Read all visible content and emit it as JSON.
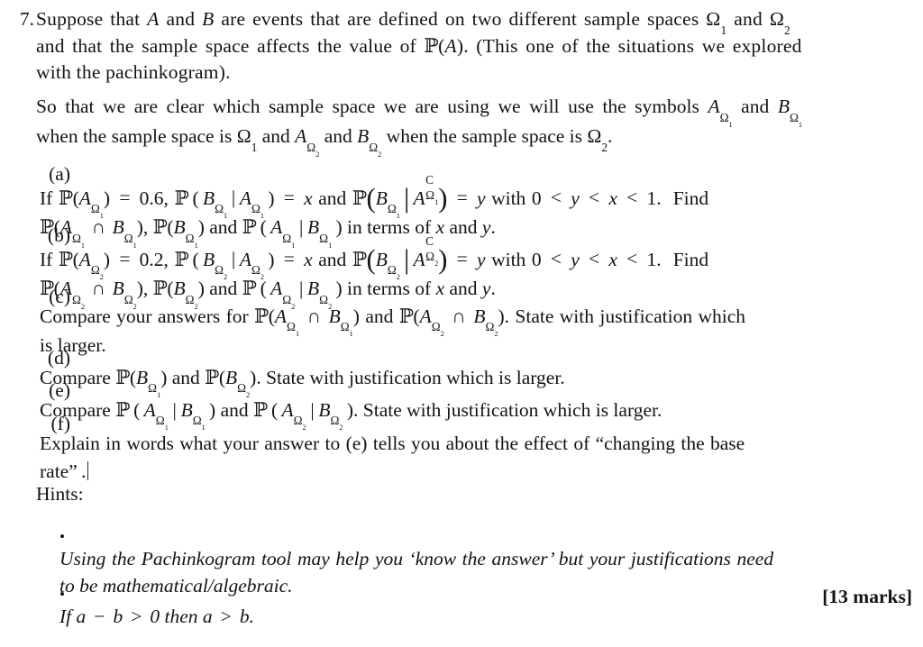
{
  "document": {
    "type": "exam-question",
    "question_number": "7.",
    "background_color": "#ffffff",
    "text_color": "#131318"
  },
  "stem": {
    "paragraph1": {
      "line1": "Suppose that A and B are events that are defined on two different sample spaces Ω₁ and Ω₂",
      "line2": "and that the sample space affects the value of P(A). (This one of the situations we explored",
      "line3": "with the pachinkogram)."
    },
    "paragraph2": {
      "line1": "So that we are clear which sample space we are using we will use the symbols A_Ω₁ and B_Ω₁",
      "line2": "when the sample space is Ω₁ and A_Ω₂ and B_Ω₂ when the sample space is Ω₂."
    }
  },
  "parts": [
    {
      "label": "(a)",
      "line1": "If P(A_Ω₁) = 0.6, P( B_Ω₁ | A_Ω₁ ) = x and P( B_Ω₁ | A^C_Ω₁ ) = y with 0 < y < x < 1.  Find",
      "line2": "P(A_Ω₁ ∩ B_Ω₁), P(B_Ω₁) and P( A_Ω₁ | B_Ω₁ ) in terms of x and y.",
      "given_probability": "0.6",
      "subscript": "1"
    },
    {
      "label": "(b)",
      "line1": "If P(A_Ω₂) = 0.2, P( B_Ω₂ | A_Ω₂ ) = x and P( B_Ω₂ | A^C_Ω₂ ) = y with 0 < y < x < 1.  Find",
      "line2": "P(A_Ω₂ ∩ B_Ω₂), P(B_Ω₂) and P( A_Ω₂ | B_Ω₂ ) in terms of x and y.",
      "given_probability": "0.2",
      "subscript": "2"
    },
    {
      "label": "(c)",
      "line1": "Compare your answers for P(A_Ω₁ ∩ B_Ω₁) and P(A_Ω₂ ∩ B_Ω₂). State with justification which",
      "line2": "is larger."
    },
    {
      "label": "(d)",
      "line1": "Compare P(B_Ω₁) and P(B_Ω₂). State with justification which is larger.",
      "line2": ""
    },
    {
      "label": "(e)",
      "line1": "Compare P( A_Ω₁ | B_Ω₁ ) and P( A_Ω₂ | B_Ω₂ ). State with justification which is larger.",
      "line2": ""
    },
    {
      "label": "(f)",
      "line1": "Explain in words what your answer to (e) tells you about the effect of “changing the base",
      "line2": "rate”.",
      "has_caret": true
    }
  ],
  "hints": {
    "heading": "Hints:",
    "items": [
      {
        "bullet": "•",
        "line1": "Using the Pachinkogram tool may help you ‘know the answer’ but your justifications need",
        "line2": "to be mathematical/algebraic."
      },
      {
        "bullet": "•",
        "line1": "If a − b > 0 then a > b.",
        "line2": ""
      }
    ]
  },
  "marks": "[13 marks]",
  "text_fragments": {
    "suppose_that": "Suppose that",
    "are_events_that_are_defined_on_two_different_sample_spaces": "are events that are defined on two different sample spaces",
    "and": "and",
    "and_that_the_sample_space_affects_the_value_of": "and that the sample space affects the value of",
    "this_one_of_the_situations_we_explored": "(This one of the situations we explored",
    "with_the_pachinkogram": "with the pachinkogram).",
    "so_that_we_are_clear": "So that we are clear which sample space we are using we will use the symbols",
    "when_the_sample_space_is": "when the sample space is",
    "if": "If",
    "with": "with",
    "find": "Find",
    "in_terms_of": "in terms of",
    "compare_your_answers_for": "Compare your answers for",
    "state_with_justification_which": "State with justification which",
    "is_larger": "is larger.",
    "state_with_justification_which_is_larger": "State with justification which is larger.",
    "compare": "Compare",
    "explain_f_line1": "Explain in words what your answer to (e) tells you about the effect of",
    "changing_the_base": "changing the base",
    "rate_word": "rate",
    "hint1_line1": "Using the Pachinkogram tool may help you",
    "hint1_know_the_answer": "know the answer",
    "hint1_tail": "but your justifications need",
    "hint1_line2": "to be mathematical/algebraic.",
    "hint2_if": "If",
    "hint2_then": "then"
  }
}
